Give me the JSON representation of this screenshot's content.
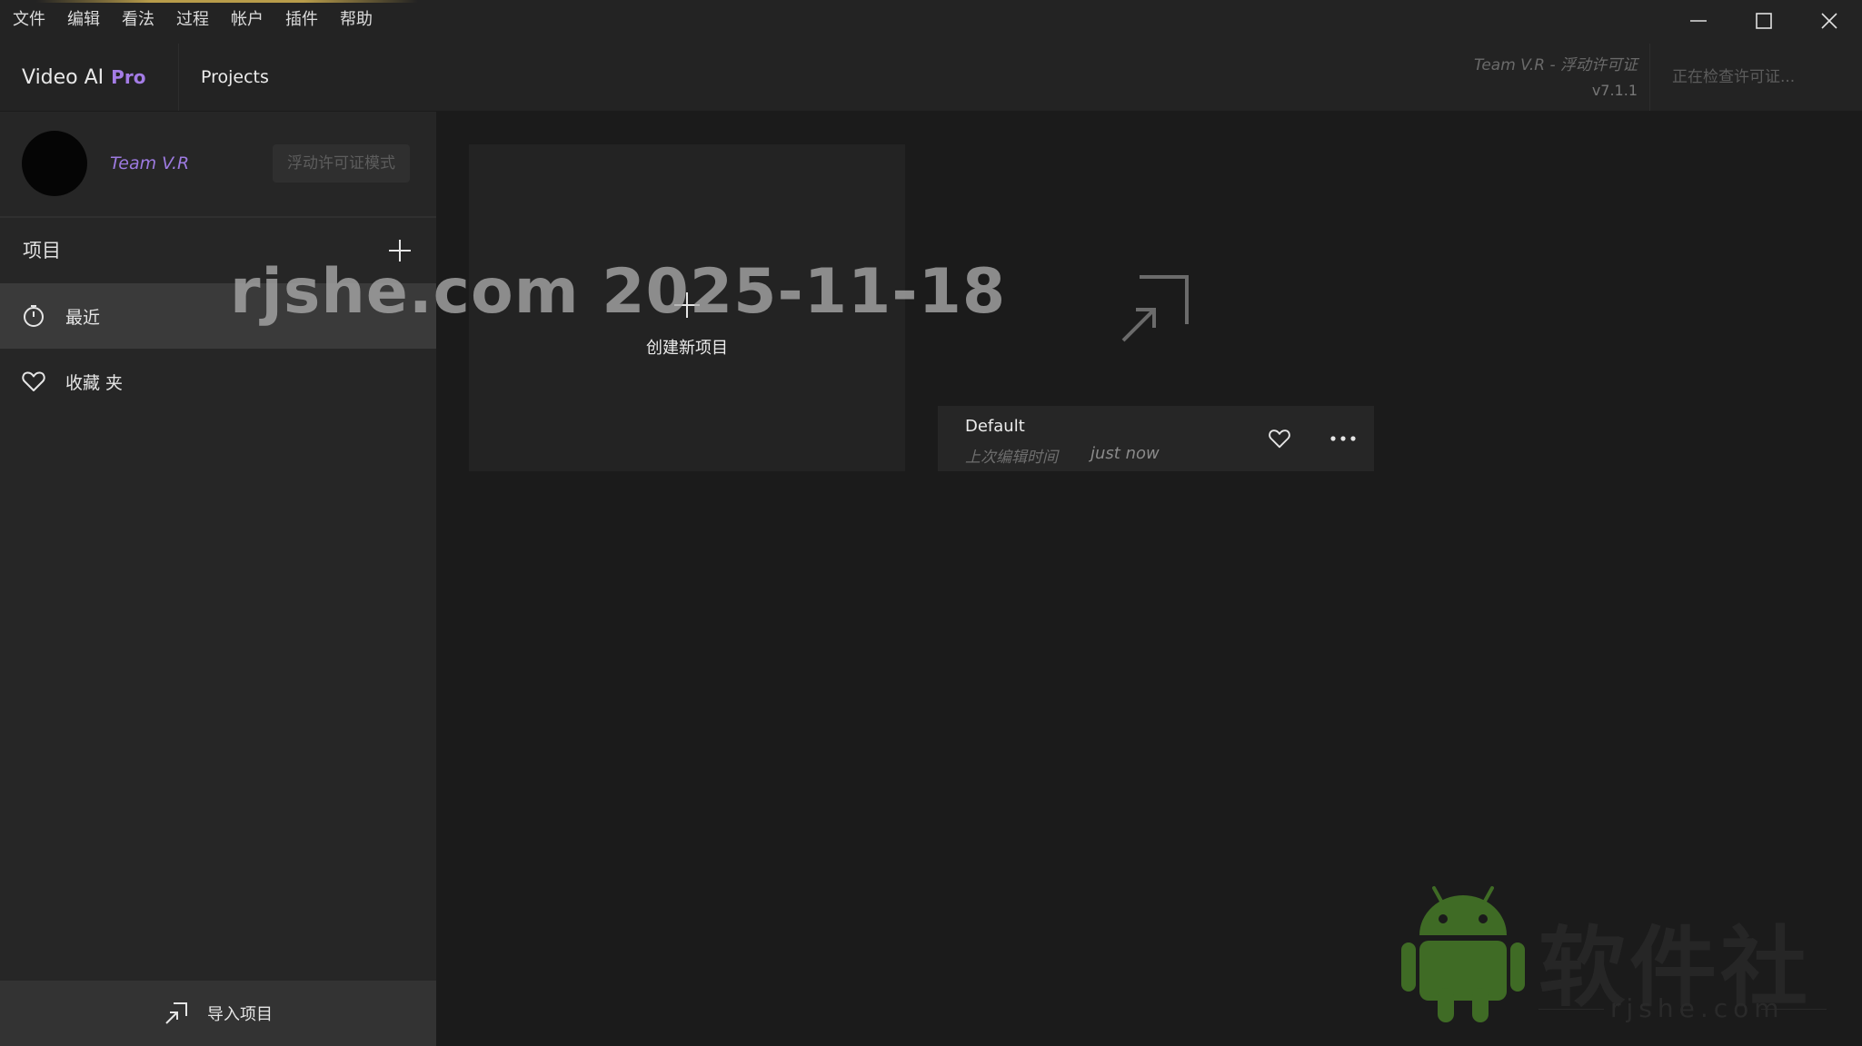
{
  "menu": {
    "items": [
      "文件",
      "编辑",
      "看法",
      "过程",
      "帐户",
      "插件",
      "帮助"
    ]
  },
  "window_controls": [
    "minimize-icon",
    "maximize-icon",
    "close-icon"
  ],
  "header": {
    "brand_name": "Video AI",
    "brand_tier": "Pro",
    "nav_projects": "Projects",
    "license_team": "Team V.R - 浮动许可证",
    "version": "v7.1.1",
    "checking_license": "正在检查许可证..."
  },
  "sidebar": {
    "user_name": "Team V.R",
    "license_mode": "浮动许可证模式",
    "projects_title": "项目",
    "items": [
      {
        "label": "最近",
        "icon": "clock-icon",
        "active": true
      },
      {
        "label": "收藏 夹",
        "icon": "heart-icon",
        "active": false
      }
    ],
    "import_label": "导入项目"
  },
  "main": {
    "create_label": "创建新项目",
    "projects": [
      {
        "name": "Default",
        "edited_label": "上次编辑时间",
        "edited_value": "just now"
      }
    ]
  },
  "watermark": {
    "text": "rjshe.com 2025-11-18",
    "brand": "软件社",
    "url": "rjshe.com"
  },
  "colors": {
    "accent_purple": "#a47ce6",
    "background": "#1b1b1b",
    "sidebar": "#262626",
    "android_green": "#3f6b25"
  }
}
